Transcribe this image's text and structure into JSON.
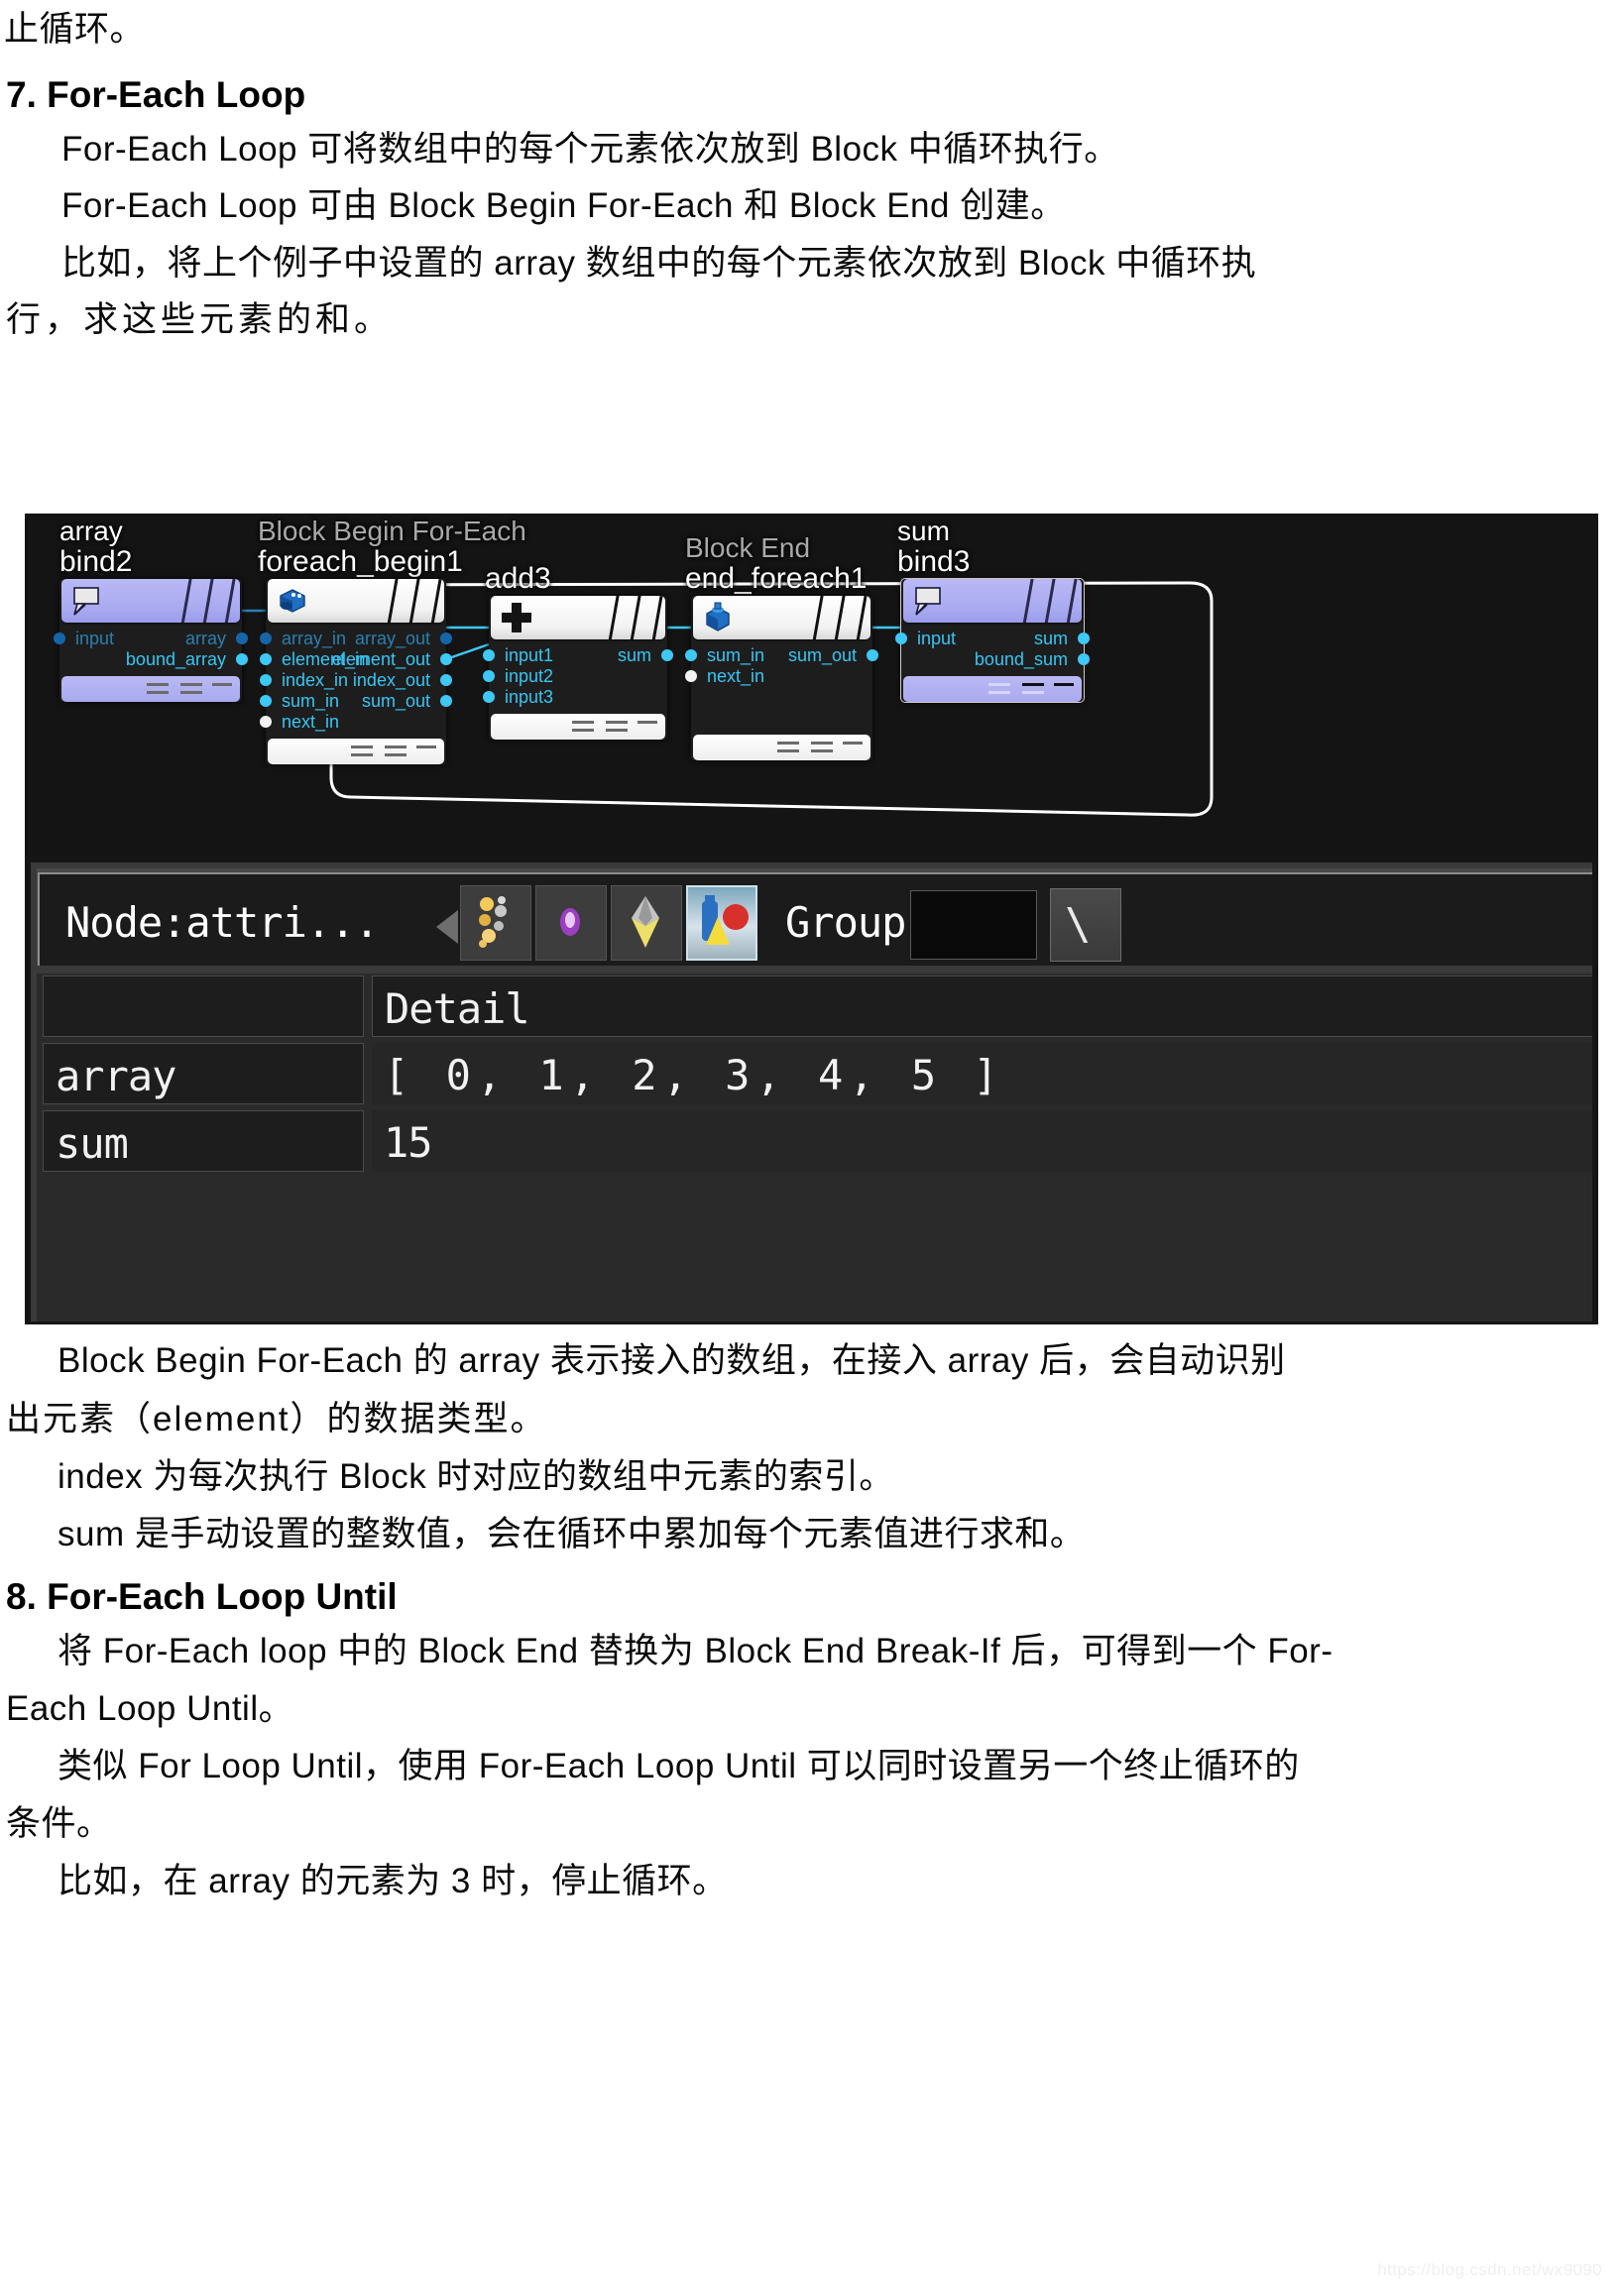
{
  "document": {
    "top_fragment": "止循环。",
    "section7": {
      "heading": "7. For-Each Loop",
      "paragraphs": [
        "For-Each Loop 可将数组中的每个元素依次放到 Block 中循环执行。",
        "For-Each Loop 可由 Block Begin For-Each 和 Block End 创建。",
        "比如，将上个例子中设置的 array 数组中的每个元素依次放到 Block 中循环执",
        "行，求这些元素的和。"
      ],
      "after_image": [
        "Block Begin For-Each 的 array 表示接入的数组，在接入 array 后，会自动识别",
        "出元素（element）的数据类型。",
        "index 为每次执行 Block 时对应的数组中元素的索引。",
        "sum 是手动设置的整数值，会在循环中累加每个元素值进行求和。"
      ]
    },
    "section8": {
      "heading": "8. For-Each Loop Until",
      "paragraphs": [
        "将 For-Each loop 中的 Block End 替换为 Block End Break-If 后，可得到一个 For-",
        "Each Loop Until。",
        "类似 For Loop Until，使用 For-Each Loop Until 可以同时设置另一个终止循环的",
        "条件。",
        "比如，在 array 的元素为 3 时，停止循环。"
      ]
    },
    "watermark": "https://blog.csdn.net/wx9090"
  },
  "screenshot": {
    "graph": {
      "nodes": [
        {
          "id": "bind2",
          "type_label": "array",
          "name": "bind2",
          "icon": "callout-bubble-icon",
          "style": "purple",
          "inputs": [
            {
              "label": "input",
              "color": "dim-blue"
            }
          ],
          "outputs": [
            {
              "label": "array",
              "color": "dim-blue"
            },
            {
              "label": "bound_array",
              "color": "cyan"
            }
          ]
        },
        {
          "id": "foreach_begin1",
          "type_label": "Block Begin For-Each",
          "name": "foreach_begin1",
          "icon": "blue-block-begin-icon",
          "style": "white",
          "inputs": [
            {
              "label": "array_in",
              "color": "dim-blue"
            },
            {
              "label": "element_in",
              "color": "cyan"
            },
            {
              "label": "index_in",
              "color": "cyan"
            },
            {
              "label": "sum_in",
              "color": "cyan"
            },
            {
              "label": "next_in",
              "color": "white"
            }
          ],
          "outputs": [
            {
              "label": "array_out",
              "color": "dim-blue"
            },
            {
              "label": "element_out",
              "color": "cyan"
            },
            {
              "label": "index_out",
              "color": "cyan"
            },
            {
              "label": "sum_out",
              "color": "cyan"
            }
          ]
        },
        {
          "id": "add3",
          "type_label": "",
          "name": "add3",
          "icon": "plus-icon",
          "style": "white",
          "inputs": [
            {
              "label": "input1",
              "color": "cyan"
            },
            {
              "label": "input2",
              "color": "cyan"
            },
            {
              "label": "input3",
              "color": "cyan"
            }
          ],
          "outputs": [
            {
              "label": "sum",
              "color": "cyan"
            }
          ]
        },
        {
          "id": "end_foreach1",
          "type_label": "Block End",
          "name": "end_foreach1",
          "icon": "blue-block-end-icon",
          "style": "white",
          "inputs": [
            {
              "label": "sum_in",
              "color": "cyan"
            },
            {
              "label": "next_in",
              "color": "white"
            }
          ],
          "outputs": [
            {
              "label": "sum_out",
              "color": "cyan"
            }
          ]
        },
        {
          "id": "bind3",
          "type_label": "sum",
          "name": "bind3",
          "icon": "callout-bubble-icon",
          "style": "purple",
          "inputs": [
            {
              "label": "input",
              "color": "cyan"
            }
          ],
          "outputs": [
            {
              "label": "sum",
              "color": "cyan"
            },
            {
              "label": "bound_sum",
              "color": "cyan"
            }
          ]
        }
      ],
      "wire_color": "#3ec8f5",
      "block_outline_color": "#ffffff"
    },
    "parameter_panel": {
      "node_label": "Node:attri...",
      "group_label": "Group:",
      "group_value": "",
      "end_button_label": "\\",
      "toolbar_icons": [
        "particles-icon",
        "purple-gem-icon",
        "diamond-icon",
        "paint-bottles-icon"
      ],
      "selected_toolbar_icon": "paint-bottles-icon"
    },
    "table": {
      "columns": [
        "",
        "Detail"
      ],
      "rows": [
        {
          "key": "array",
          "value": "[ 0, 1, 2, 3, 4, 5 ]"
        },
        {
          "key": "sum",
          "value": "15"
        }
      ]
    }
  }
}
